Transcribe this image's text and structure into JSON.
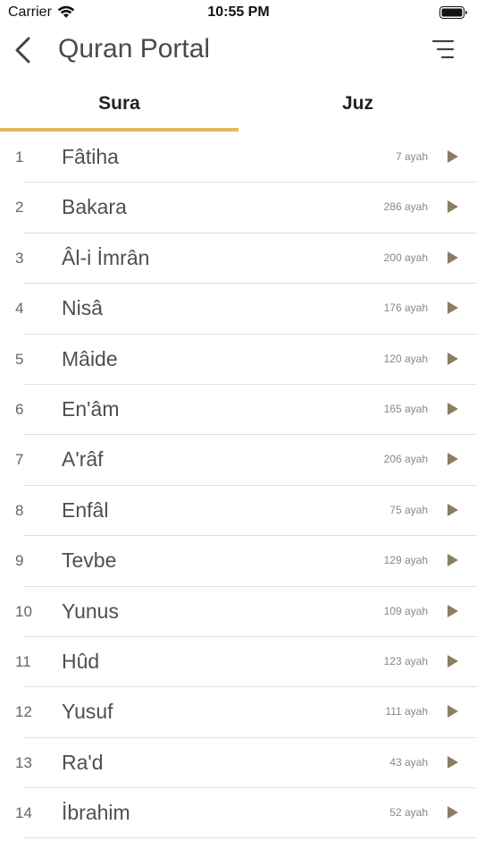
{
  "status": {
    "carrier": "Carrier",
    "time": "10:55 PM"
  },
  "header": {
    "title": "Quran Portal"
  },
  "tabs": [
    {
      "label": "Sura",
      "active": true
    },
    {
      "label": "Juz",
      "active": false
    }
  ],
  "colors": {
    "accent": "#e2b85a",
    "play": "#8a7f63"
  },
  "suras": [
    {
      "number": "1",
      "name": "Fâtiha",
      "count": "7 ayah"
    },
    {
      "number": "2",
      "name": "Bakara",
      "count": "286 ayah"
    },
    {
      "number": "3",
      "name": "Âl-i İmrân",
      "count": "200 ayah"
    },
    {
      "number": "4",
      "name": "Nisâ",
      "count": "176 ayah"
    },
    {
      "number": "5",
      "name": "Mâide",
      "count": "120 ayah"
    },
    {
      "number": "6",
      "name": "En'âm",
      "count": "165 ayah"
    },
    {
      "number": "7",
      "name": "A'râf",
      "count": "206 ayah"
    },
    {
      "number": "8",
      "name": "Enfâl",
      "count": "75 ayah"
    },
    {
      "number": "9",
      "name": "Tevbe",
      "count": "129 ayah"
    },
    {
      "number": "10",
      "name": "Yunus",
      "count": "109 ayah"
    },
    {
      "number": "11",
      "name": "Hûd",
      "count": "123 ayah"
    },
    {
      "number": "12",
      "name": "Yusuf",
      "count": "111 ayah"
    },
    {
      "number": "13",
      "name": "Ra'd",
      "count": "43 ayah"
    },
    {
      "number": "14",
      "name": "İbrahim",
      "count": "52 ayah"
    }
  ]
}
